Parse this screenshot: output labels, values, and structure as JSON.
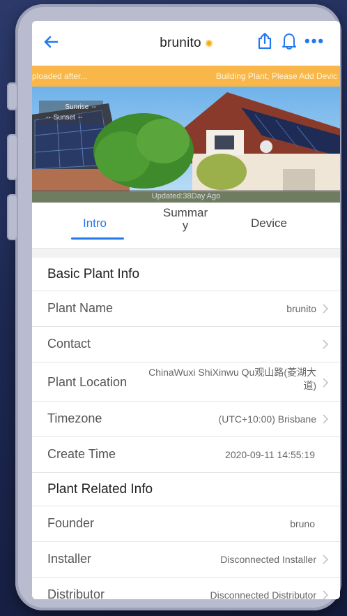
{
  "navbar": {
    "title": "brunito",
    "back_icon": "back-arrow-icon",
    "share_icon": "share-icon",
    "bell_icon": "bell-icon",
    "more_icon": "more-dots-icon",
    "more_label": "•••",
    "accent": "#2478f0",
    "status_color": "#f5a623"
  },
  "banner": {
    "left_text": "ploaded after...",
    "right_text": "Building Plant, Please Add Devic",
    "color": "#f8b748"
  },
  "hero": {
    "sunrise_label": "Sunrise",
    "sunrise_value": "--",
    "sunset_prefix": "--",
    "sunset_label": "Sunset",
    "sunset_value": "--",
    "updated_text": "Updated:38Day Ago"
  },
  "tabs": [
    {
      "label": "Intro",
      "active": true
    },
    {
      "label": "Summar\ny",
      "active": false
    },
    {
      "label": "Device",
      "active": false
    }
  ],
  "basic_info": {
    "title": "Basic Plant Info",
    "rows": [
      {
        "label": "Plant Name",
        "value": "brunito",
        "arrow": true
      },
      {
        "label": "Contact",
        "value": "",
        "arrow": true
      },
      {
        "label": "Plant Location",
        "value": "ChinaWuxi ShiXinwu Qu观山路(菱湖大道)",
        "arrow": true
      },
      {
        "label": "Timezone",
        "value": "(UTC+10:00) Brisbane",
        "arrow": true
      },
      {
        "label": "Create Time",
        "value": "2020-09-11 14:55:19",
        "arrow": false
      }
    ]
  },
  "related_info": {
    "title": "Plant Related Info",
    "rows": [
      {
        "label": "Founder",
        "value": "bruno",
        "arrow": false
      },
      {
        "label": "Installer",
        "value": "Disconnected Installer",
        "arrow": true
      },
      {
        "label": "Distributor",
        "value": "Disconnected Distributor",
        "arrow": true
      }
    ]
  }
}
